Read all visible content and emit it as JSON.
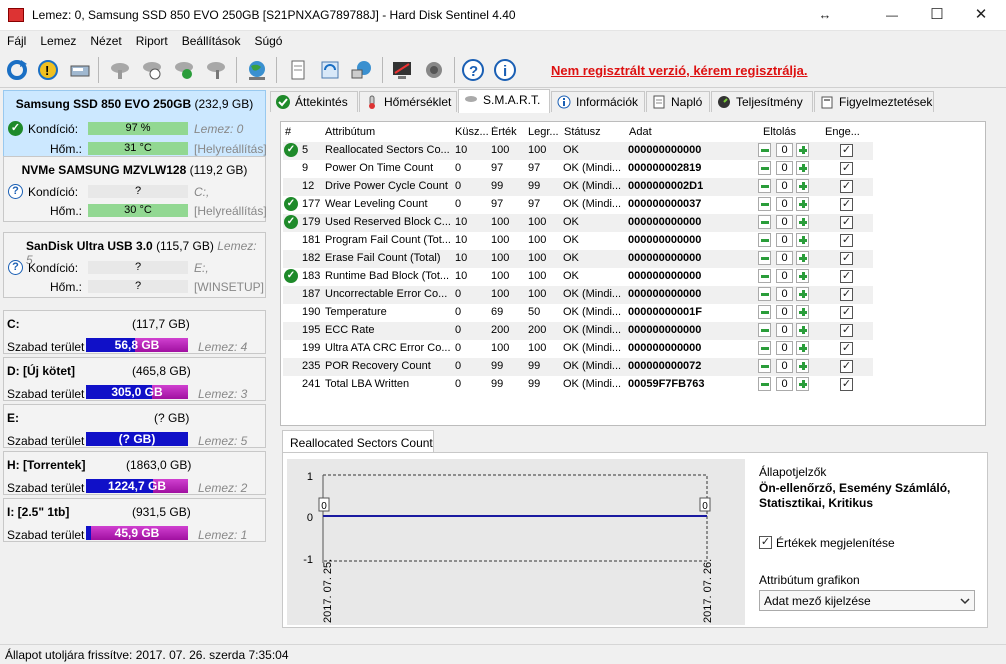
{
  "window": {
    "title": "Lemez: 0, Samsung SSD 850 EVO 250GB [S21PNXAG789788J]  -  Hard Disk Sentinel 4.40",
    "restore_glyph": "↔",
    "min_glyph": "—",
    "max_glyph": "☐",
    "close_glyph": "✕"
  },
  "menu": [
    "Fájl",
    "Lemez",
    "Nézet",
    "Riport",
    "Beállítások",
    "Súgó"
  ],
  "toolbar": {
    "register_text": "Nem regisztrált verzió, kérem regisztrálja.",
    "help_glyph": "?",
    "info_glyph": "i"
  },
  "disks": [
    {
      "name": "Samsung SSD 850 EVO 250GB",
      "size": "(232,9 GB)",
      "cond_label": "Kondíció:",
      "cond_value": "97 %",
      "cond_meta": "Lemez: 0",
      "temp_label": "Hőm.:",
      "temp_value": "31 °C",
      "temp_meta": "[Helyreállítás]",
      "status_icon": "ok-icon"
    },
    {
      "name": "NVMe   SAMSUNG MZVLW128",
      "size": "(119,2 GB)",
      "cond_label": "Kondíció:",
      "cond_value": "?",
      "cond_meta": "C:,",
      "temp_label": "Hőm.:",
      "temp_value": "30 °C",
      "temp_meta": "[Helyreállítás]",
      "status_icon": "question-icon"
    },
    {
      "name": "SanDisk Ultra USB 3.0",
      "size": "(115,7 GB)",
      "size_meta": "Lemez: 5",
      "cond_label": "Kondíció:",
      "cond_value": "?",
      "cond_meta": "E:,",
      "temp_label": "Hőm.:",
      "temp_value": "?",
      "temp_meta": "[WINSETUP]",
      "status_icon": "question-icon"
    }
  ],
  "volumes": [
    {
      "name": "C:",
      "size": "(117,7 GB)",
      "free_label": "Szabad terület",
      "free": "56,8 GB",
      "free_fraction": 0.48,
      "disk": "Lemez: 4"
    },
    {
      "name": "D: [Új kötet]",
      "size": "(465,8 GB)",
      "free_label": "Szabad terület",
      "free": "305,0 GB",
      "free_fraction": 0.65,
      "disk": "Lemez: 3"
    },
    {
      "name": "E:",
      "size": "(? GB)",
      "free_label": "Szabad terület",
      "free": "(? GB)",
      "free_fraction": 0,
      "disk": "Lemez: 5"
    },
    {
      "name": "H: [Torrentek]",
      "size": "(1863,0 GB)",
      "free_label": "Szabad terület",
      "free": "1224,7 GB",
      "free_fraction": 0.66,
      "disk": "Lemez: 2"
    },
    {
      "name": "I: [2.5\" 1tb]",
      "size": "(931,5 GB)",
      "free_label": "Szabad terület",
      "free": "45,9 GB",
      "free_fraction": 0.05,
      "disk": "Lemez: 1"
    }
  ],
  "tabs": [
    "Áttekintés",
    "Hőmérséklet",
    "S.M.A.R.T.",
    "Információk",
    "Napló",
    "Teljesítmény",
    "Figyelmeztetések"
  ],
  "smart": {
    "headers": [
      "#",
      "Attribútum",
      "Küsz...",
      "Érték",
      "Legr...",
      "Státusz",
      "Adat",
      "Eltolás",
      "Enge..."
    ],
    "rows": [
      {
        "icon": true,
        "id": "5",
        "attr": "Reallocated Sectors Co...",
        "thr": "10",
        "val": "100",
        "worst": "100",
        "status": "OK",
        "data": "000000000000",
        "offset": "0"
      },
      {
        "icon": false,
        "id": "9",
        "attr": "Power On Time Count",
        "thr": "0",
        "val": "97",
        "worst": "97",
        "status": "OK (Mindi...",
        "data": "000000002819",
        "offset": "0"
      },
      {
        "icon": false,
        "id": "12",
        "attr": "Drive Power Cycle Count",
        "thr": "0",
        "val": "99",
        "worst": "99",
        "status": "OK (Mindi...",
        "data": "0000000002D1",
        "offset": "0"
      },
      {
        "icon": true,
        "id": "177",
        "attr": "Wear Leveling Count",
        "thr": "0",
        "val": "97",
        "worst": "97",
        "status": "OK (Mindi...",
        "data": "000000000037",
        "offset": "0"
      },
      {
        "icon": true,
        "id": "179",
        "attr": "Used Reserved Block C...",
        "thr": "10",
        "val": "100",
        "worst": "100",
        "status": "OK",
        "data": "000000000000",
        "offset": "0"
      },
      {
        "icon": false,
        "id": "181",
        "attr": "Program Fail Count (Tot...",
        "thr": "10",
        "val": "100",
        "worst": "100",
        "status": "OK",
        "data": "000000000000",
        "offset": "0"
      },
      {
        "icon": false,
        "id": "182",
        "attr": "Erase Fail Count (Total)",
        "thr": "10",
        "val": "100",
        "worst": "100",
        "status": "OK",
        "data": "000000000000",
        "offset": "0"
      },
      {
        "icon": true,
        "id": "183",
        "attr": "Runtime Bad Block (Tot...",
        "thr": "10",
        "val": "100",
        "worst": "100",
        "status": "OK",
        "data": "000000000000",
        "offset": "0"
      },
      {
        "icon": false,
        "id": "187",
        "attr": "Uncorrectable Error Co...",
        "thr": "0",
        "val": "100",
        "worst": "100",
        "status": "OK (Mindi...",
        "data": "000000000000",
        "offset": "0"
      },
      {
        "icon": false,
        "id": "190",
        "attr": "Temperature",
        "thr": "0",
        "val": "69",
        "worst": "50",
        "status": "OK (Mindi...",
        "data": "00000000001F",
        "offset": "0"
      },
      {
        "icon": false,
        "id": "195",
        "attr": "ECC Rate",
        "thr": "0",
        "val": "200",
        "worst": "200",
        "status": "OK (Mindi...",
        "data": "000000000000",
        "offset": "0"
      },
      {
        "icon": false,
        "id": "199",
        "attr": "Ultra ATA CRC Error Co...",
        "thr": "0",
        "val": "100",
        "worst": "100",
        "status": "OK (Mindi...",
        "data": "000000000000",
        "offset": "0"
      },
      {
        "icon": false,
        "id": "235",
        "attr": "POR Recovery Count",
        "thr": "0",
        "val": "99",
        "worst": "99",
        "status": "OK (Mindi...",
        "data": "000000000072",
        "offset": "0"
      },
      {
        "icon": false,
        "id": "241",
        "attr": "Total LBA Written",
        "thr": "0",
        "val": "99",
        "worst": "99",
        "status": "OK (Mindi...",
        "data": "00059F7FB763",
        "offset": "0"
      }
    ]
  },
  "graph": {
    "tab_title": "Reallocated Sectors Count",
    "y_ticks": [
      "1",
      "0",
      "-1"
    ],
    "point_labels": [
      "0",
      "0"
    ],
    "x_labels": [
      "2017. 07. 25.",
      "2017. 07. 26."
    ],
    "side_title": "Állapotjelzők",
    "side_bold": "Ön-ellenőrző, Esemény Számláló, Statisztikai, Kritikus",
    "show_values_label": "Értékek megjelenítése",
    "attr_graph_label": "Attribútum grafikon",
    "select_value": "Adat mező kijelzése",
    "series_color": "#1a1aa0"
  },
  "statusbar": {
    "text": "Állapot utoljára frissítve: 2017. 07. 26. szerda 7:35:04"
  }
}
